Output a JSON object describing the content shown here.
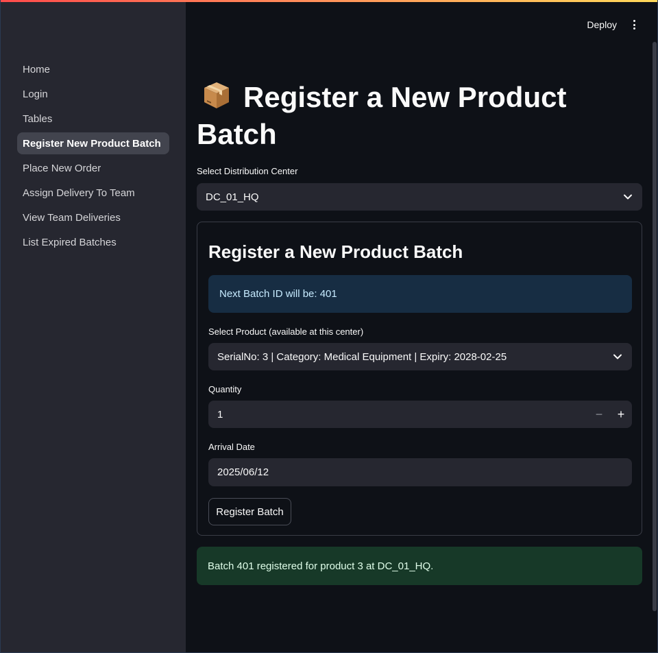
{
  "sidebar": {
    "items": [
      {
        "label": "Home"
      },
      {
        "label": "Login"
      },
      {
        "label": "Tables"
      },
      {
        "label": "Register New Product Batch",
        "active": true
      },
      {
        "label": "Place New Order"
      },
      {
        "label": "Assign Delivery To Team"
      },
      {
        "label": "View Team Deliveries"
      },
      {
        "label": "List Expired Batches"
      }
    ]
  },
  "header": {
    "deploy_label": "Deploy",
    "menu_icon": "vertical-ellipsis-icon"
  },
  "page": {
    "title_icon": "package-icon",
    "title": "Register a New Product Batch"
  },
  "distribution_center": {
    "label": "Select Distribution Center",
    "selected": "DC_01_HQ"
  },
  "form": {
    "title": "Register a New Product Batch",
    "info": "Next Batch ID will be: 401",
    "product": {
      "label": "Select Product (available at this center)",
      "selected": "SerialNo: 3 | Category: Medical Equipment | Expiry: 2028-02-25"
    },
    "quantity": {
      "label": "Quantity",
      "value": "1",
      "decrement": "−",
      "increment": "+"
    },
    "arrival_date": {
      "label": "Arrival Date",
      "value": "2025/06/12"
    },
    "submit_label": "Register Batch"
  },
  "success_message": "Batch 401 registered for product 3 at DC_01_HQ.",
  "colors": {
    "sidebar_bg": "#262730",
    "main_bg": "#0e1117",
    "info_bg": "#172d43",
    "success_bg": "#173928",
    "accent": "#ff4b4b"
  }
}
